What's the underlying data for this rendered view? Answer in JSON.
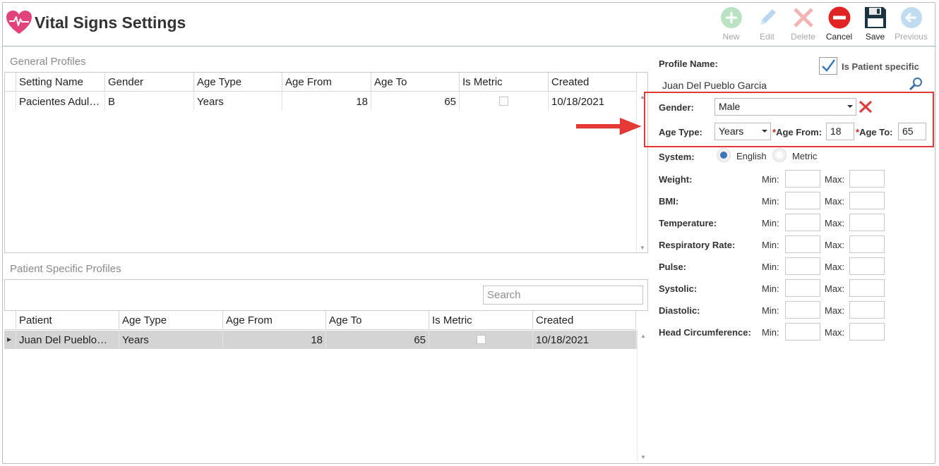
{
  "app": {
    "title": "Vital Signs Settings",
    "accent": "#e0447a"
  },
  "toolbar": {
    "new_label": "New",
    "edit_label": "Edit",
    "delete_label": "Delete",
    "cancel_label": "Cancel",
    "save_label": "Save",
    "previous_label": "Previous"
  },
  "general_profiles": {
    "title": "General Profiles",
    "columns": [
      "Setting Name",
      "Gender",
      "Age Type",
      "Age From",
      "Age To",
      "Is Metric",
      "Created"
    ],
    "rows": [
      {
        "setting_name": "Pacientes Adul…",
        "gender": "B",
        "age_type": "Years",
        "age_from": "18",
        "age_to": "65",
        "is_metric": false,
        "created": "10/18/2021"
      }
    ]
  },
  "patient_profiles": {
    "title": "Patient Specific Profiles",
    "search_placeholder": "Search",
    "columns": [
      "Patient",
      "Age Type",
      "Age From",
      "Age To",
      "Is Metric",
      "Created"
    ],
    "rows": [
      {
        "patient": "Juan Del Pueblo…",
        "age_type": "Years",
        "age_from": "18",
        "age_to": "65",
        "is_metric": false,
        "created": "10/18/2021"
      }
    ]
  },
  "form": {
    "profile_name_label": "Profile Name:",
    "is_patient_specific_label": "Is Patient specific",
    "is_patient_specific": true,
    "patient_name": "Juan Del Pueblo Garcia",
    "gender_label": "Gender:",
    "gender_value": "Male",
    "age_type_label": "Age Type:",
    "age_type_value": "Years",
    "required_mark": "*",
    "age_from_label": "Age From:",
    "age_from_value": "18",
    "age_to_label": "Age To:",
    "age_to_value": "65",
    "system_label": "System:",
    "system_options": [
      "English",
      "Metric"
    ],
    "system_selected": "English",
    "min_label": "Min:",
    "max_label": "Max:",
    "vitals": [
      "Weight:",
      "BMI:",
      "Temperature:",
      "Respiratory Rate:",
      "Pulse:",
      "Systolic:",
      "Diastolic:",
      "Head Circumference:"
    ]
  },
  "colors": {
    "highlight": "#e53935",
    "arrow": "#e53935",
    "selected_row": "#d4d4d4"
  }
}
